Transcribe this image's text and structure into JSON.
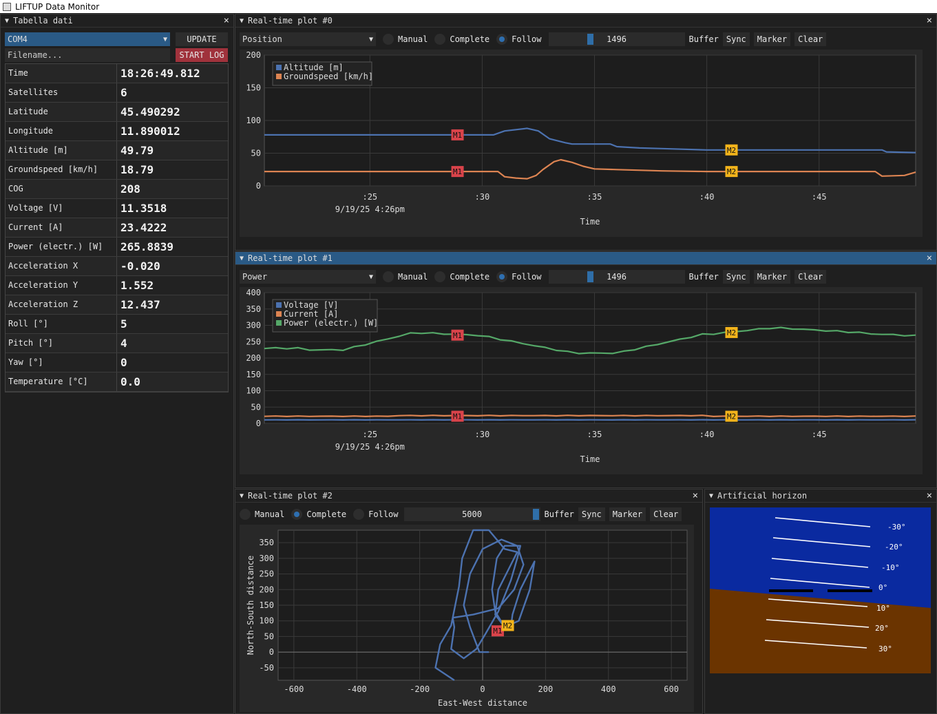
{
  "window": {
    "title": "LIFTUP Data Monitor"
  },
  "colors": {
    "accent": "#2a5a86",
    "series_blue": "#4c72b0",
    "series_orange": "#dd8452",
    "series_green": "#55a868",
    "marker_m1": "#d9434a",
    "marker_m2": "#f2b31b",
    "sky": "#0a2aa0",
    "ground": "#6b3400"
  },
  "table_panel": {
    "title": "Tabella dati",
    "port": "COM4",
    "update_label": "UPDATE",
    "filename_placeholder": "Filename...",
    "start_log_label": "START LOG",
    "rows": [
      {
        "key": "Time",
        "value": "18:26:49.812"
      },
      {
        "key": "Satellites",
        "value": "6"
      },
      {
        "key": "Latitude",
        "value": "45.490292"
      },
      {
        "key": "Longitude",
        "value": "11.890012"
      },
      {
        "key": "Altitude [m]",
        "value": "49.79"
      },
      {
        "key": "Groundspeed [km/h]",
        "value": "18.79"
      },
      {
        "key": "COG",
        "value": "208"
      },
      {
        "key": "Voltage [V]",
        "value": "11.3518"
      },
      {
        "key": "Current [A]",
        "value": "23.4222"
      },
      {
        "key": "Power (electr.) [W]",
        "value": "265.8839"
      },
      {
        "key": "Acceleration X",
        "value": "-0.020"
      },
      {
        "key": "Acceleration Y",
        "value": "1.552"
      },
      {
        "key": "Acceleration Z",
        "value": "12.437"
      },
      {
        "key": "Roll [°]",
        "value": "5"
      },
      {
        "key": "Pitch [°]",
        "value": "4"
      },
      {
        "key": "Yaw [°]",
        "value": "0"
      },
      {
        "key": "Temperature [°C]",
        "value": "0.0"
      }
    ]
  },
  "plot0": {
    "title": "Real-time plot #0",
    "selector": "Position",
    "modes": [
      "Manual",
      "Complete",
      "Follow"
    ],
    "active_mode": "Follow",
    "slider_value": "1496",
    "buttons": [
      "Buffer",
      "Sync",
      "Marker",
      "Clear"
    ],
    "xticks": [
      ":25",
      ":30",
      ":35",
      ":40",
      ":45"
    ],
    "date_label": "9/19/25 4:26pm",
    "xlabel": "Time",
    "yticks": [
      "200",
      "150",
      "100",
      "50",
      "0"
    ],
    "legend": [
      "Altitude [m]",
      "Groundspeed [km/h]"
    ],
    "markers": [
      "M1",
      "M2"
    ]
  },
  "plot1": {
    "title": "Real-time plot #1",
    "selector": "Power",
    "modes": [
      "Manual",
      "Complete",
      "Follow"
    ],
    "active_mode": "Follow",
    "slider_value": "1496",
    "buttons": [
      "Buffer",
      "Sync",
      "Marker",
      "Clear"
    ],
    "xticks": [
      ":25",
      ":30",
      ":35",
      ":40",
      ":45"
    ],
    "date_label": "9/19/25 4:26pm",
    "xlabel": "Time",
    "yticks": [
      "400",
      "350",
      "300",
      "250",
      "200",
      "150",
      "100",
      "50",
      "0"
    ],
    "legend": [
      "Voltage [V]",
      "Current [A]",
      "Power (electr.) [W]"
    ],
    "markers": [
      "M1",
      "M2"
    ]
  },
  "plot2": {
    "title": "Real-time plot #2",
    "modes": [
      "Manual",
      "Complete",
      "Follow"
    ],
    "active_mode": "Complete",
    "slider_value": "5000",
    "buttons": [
      "Buffer",
      "Sync",
      "Marker",
      "Clear"
    ],
    "xticks": [
      "-600",
      "-400",
      "-200",
      "0",
      "200",
      "400",
      "600"
    ],
    "yticks": [
      "350",
      "300",
      "250",
      "200",
      "150",
      "100",
      "50",
      "0",
      "-50"
    ],
    "xlabel": "East-West distance",
    "ylabel": "North-South distance",
    "markers": [
      "M1",
      "M2"
    ]
  },
  "horizon": {
    "title": "Artificial horizon",
    "pitch_labels": [
      "-30°",
      "-20°",
      "-10°",
      "0°",
      "10°",
      "20°",
      "30°"
    ]
  },
  "chart_data": [
    {
      "type": "line",
      "x": [
        ":25",
        ":30",
        ":35",
        ":40",
        ":45"
      ],
      "xlabel": "Time",
      "ylim": [
        0,
        200
      ],
      "series": [
        {
          "name": "Altitude [m]",
          "values": [
            78,
            78,
            64,
            55,
            55
          ]
        },
        {
          "name": "Groundspeed [km/h]",
          "values": [
            22,
            22,
            28,
            22,
            20
          ]
        }
      ]
    },
    {
      "type": "line",
      "x": [
        ":25",
        ":30",
        ":35",
        ":40",
        ":45"
      ],
      "xlabel": "Time",
      "ylim": [
        0,
        400
      ],
      "series": [
        {
          "name": "Voltage [V]",
          "values": [
            11,
            11,
            11,
            11,
            11
          ]
        },
        {
          "name": "Current [A]",
          "values": [
            22,
            24,
            22,
            24,
            23
          ]
        },
        {
          "name": "Power (electr.) [W]",
          "values": [
            245,
            270,
            215,
            275,
            280
          ]
        }
      ]
    },
    {
      "type": "line",
      "xlabel": "East-West distance",
      "ylabel": "North-South distance",
      "xlim": [
        -650,
        650
      ],
      "ylim": [
        -90,
        390
      ]
    }
  ]
}
